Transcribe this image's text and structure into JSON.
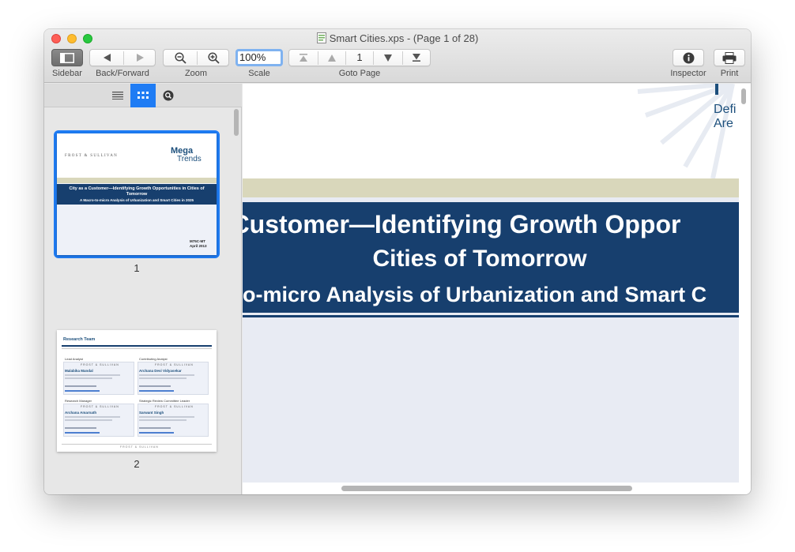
{
  "window": {
    "title": "Smart Cities.xps - (Page 1 of 28)"
  },
  "toolbar": {
    "sidebar_label": "Sidebar",
    "back_forward_label": "Back/Forward",
    "zoom_label": "Zoom",
    "scale_label": "Scale",
    "scale_value": "100%",
    "goto_label": "Goto Page",
    "current_page": "1",
    "inspector_label": "Inspector",
    "print_label": "Print"
  },
  "sidebar": {
    "tabs": [
      "list-view",
      "thumbnail-view",
      "search"
    ],
    "active_tab": "thumbnail-view",
    "thumbnails": [
      {
        "page_number": "1",
        "brand": "FROST & SULLIVAN",
        "logo_line1": "Mega",
        "logo_line2": "Trends",
        "title": "City as a Customer—Identifying Growth Opportunities in Cities of Tomorrow",
        "subtitle": "A Macro-to-micro Analysis of Urbanization and Smart Cities in 2025",
        "code": "M75C-MT",
        "date": "April 2013"
      },
      {
        "page_number": "2",
        "heading": "Research Team",
        "brand": "FROST & SULLIVAN",
        "roles": [
          "Lead Analyst",
          "Contributing Analyst",
          "Research Manager",
          "Strategic Review Committee Leader"
        ],
        "names": [
          "Malabika Mandal",
          "Archana Devi Vidyasekar",
          "Archana Amarnath",
          "Sarwant Singh"
        ]
      }
    ]
  },
  "document": {
    "headline_line1": "Customer—Identifying Growth Oppor",
    "headline_line2": "Cities of Tomorrow",
    "headline_line3": "o-micro Analysis of Urbanization and Smart C",
    "partial_text_1": "Defi",
    "partial_text_2": "Are"
  }
}
